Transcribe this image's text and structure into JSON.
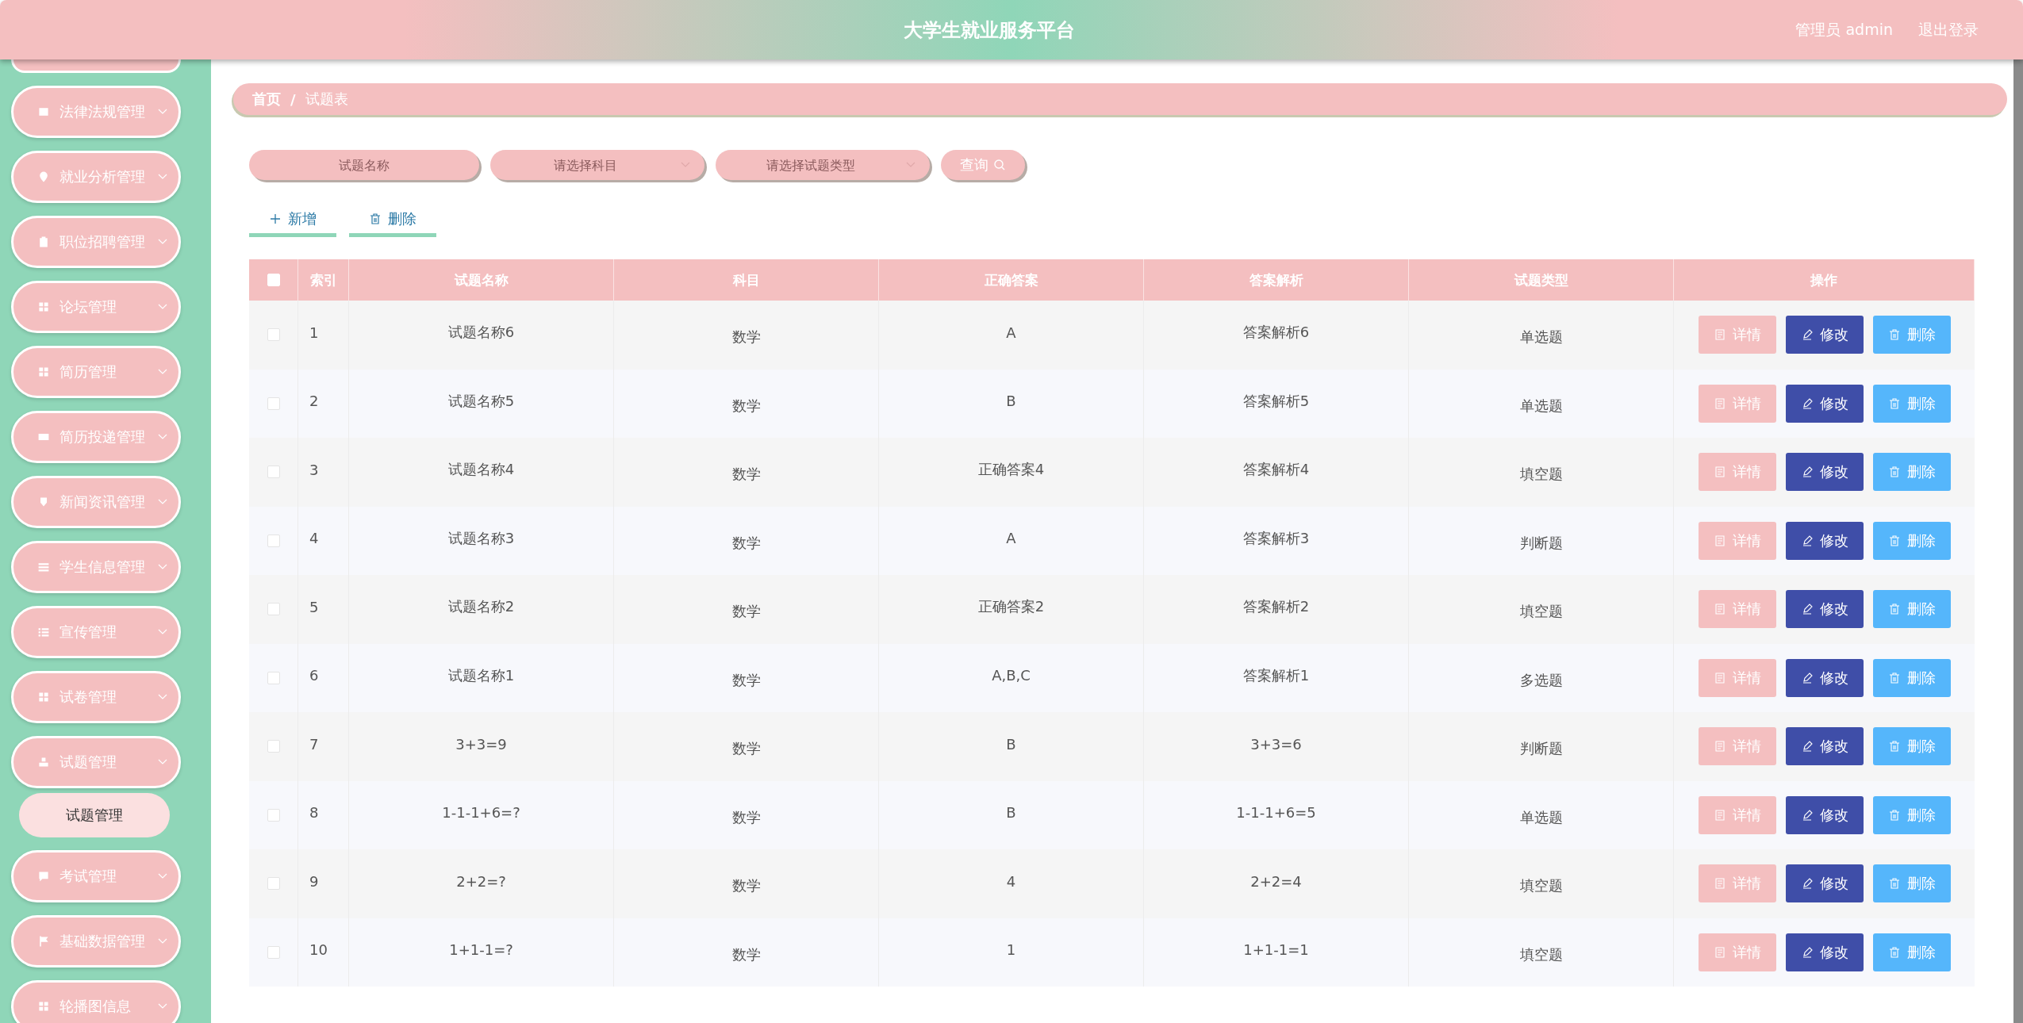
{
  "header": {
    "title": "大学生就业服务平台",
    "user": "管理员 admin",
    "logout": "退出登录"
  },
  "sidebar": {
    "items": [
      {
        "label": "法律法规管理"
      },
      {
        "label": "就业分析管理"
      },
      {
        "label": "职位招聘管理"
      },
      {
        "label": "论坛管理"
      },
      {
        "label": "简历管理"
      },
      {
        "label": "简历投递管理"
      },
      {
        "label": "新闻资讯管理"
      },
      {
        "label": "学生信息管理"
      },
      {
        "label": "宣传管理"
      },
      {
        "label": "试卷管理"
      },
      {
        "label": "试题管理",
        "children": [
          {
            "label": "试题管理"
          }
        ]
      },
      {
        "label": "考试管理"
      },
      {
        "label": "基础数据管理"
      },
      {
        "label": "轮播图信息"
      }
    ]
  },
  "breadcrumb": {
    "items": [
      "首页",
      "试题表"
    ],
    "separator": "/"
  },
  "search": {
    "fields": [
      {
        "kind": "input",
        "placeholder": "试题名称"
      },
      {
        "kind": "select",
        "placeholder": "请选择科目"
      },
      {
        "kind": "select",
        "placeholder": "请选择试题类型"
      }
    ],
    "button": "查询"
  },
  "toolbar": [
    {
      "kind": "add",
      "label": "新增"
    },
    {
      "kind": "delete",
      "label": "删除"
    }
  ],
  "table": {
    "select_all": {
      "checked": false
    },
    "columns": [
      "索引",
      "试题名称",
      "科目",
      "正确答案",
      "答案解析",
      "试题类型",
      "操作"
    ],
    "rows": [
      {
        "checked": false,
        "cells": [
          "1",
          "试题名称6",
          "数学",
          "A",
          "答案解析6",
          "单选题"
        ],
        "actions": [
          {
            "kind": "detail",
            "label": "详情"
          },
          {
            "kind": "edit",
            "label": "修改"
          },
          {
            "kind": "delete",
            "label": "删除"
          }
        ]
      },
      {
        "checked": false,
        "cells": [
          "2",
          "试题名称5",
          "数学",
          "B",
          "答案解析5",
          "单选题"
        ],
        "actions": [
          {
            "kind": "detail",
            "label": "详情"
          },
          {
            "kind": "edit",
            "label": "修改"
          },
          {
            "kind": "delete",
            "label": "删除"
          }
        ]
      },
      {
        "checked": false,
        "cells": [
          "3",
          "试题名称4",
          "数学",
          "正确答案4",
          "答案解析4",
          "填空题"
        ],
        "actions": [
          {
            "kind": "detail",
            "label": "详情"
          },
          {
            "kind": "edit",
            "label": "修改"
          },
          {
            "kind": "delete",
            "label": "删除"
          }
        ]
      },
      {
        "checked": false,
        "cells": [
          "4",
          "试题名称3",
          "数学",
          "A",
          "答案解析3",
          "判断题"
        ],
        "actions": [
          {
            "kind": "detail",
            "label": "详情"
          },
          {
            "kind": "edit",
            "label": "修改"
          },
          {
            "kind": "delete",
            "label": "删除"
          }
        ]
      },
      {
        "checked": false,
        "cells": [
          "5",
          "试题名称2",
          "数学",
          "正确答案2",
          "答案解析2",
          "填空题"
        ],
        "actions": [
          {
            "kind": "detail",
            "label": "详情"
          },
          {
            "kind": "edit",
            "label": "修改"
          },
          {
            "kind": "delete",
            "label": "删除"
          }
        ]
      },
      {
        "checked": false,
        "cells": [
          "6",
          "试题名称1",
          "数学",
          "A,B,C",
          "答案解析1",
          "多选题"
        ],
        "actions": [
          {
            "kind": "detail",
            "label": "详情"
          },
          {
            "kind": "edit",
            "label": "修改"
          },
          {
            "kind": "delete",
            "label": "删除"
          }
        ]
      },
      {
        "checked": false,
        "cells": [
          "7",
          "3+3=9",
          "数学",
          "B",
          "3+3=6",
          "判断题"
        ],
        "actions": [
          {
            "kind": "detail",
            "label": "详情"
          },
          {
            "kind": "edit",
            "label": "修改"
          },
          {
            "kind": "delete",
            "label": "删除"
          }
        ]
      },
      {
        "checked": false,
        "cells": [
          "8",
          "1-1-1+6=?",
          "数学",
          "B",
          "1-1-1+6=5",
          "单选题"
        ],
        "actions": [
          {
            "kind": "detail",
            "label": "详情"
          },
          {
            "kind": "edit",
            "label": "修改"
          },
          {
            "kind": "delete",
            "label": "删除"
          }
        ]
      },
      {
        "checked": false,
        "cells": [
          "9",
          "2+2=?",
          "数学",
          "4",
          "2+2=4",
          "填空题"
        ],
        "actions": [
          {
            "kind": "detail",
            "label": "详情"
          },
          {
            "kind": "edit",
            "label": "修改"
          },
          {
            "kind": "delete",
            "label": "删除"
          }
        ]
      },
      {
        "checked": false,
        "cells": [
          "10",
          "1+1-1=?",
          "数学",
          "1",
          "1+1-1=1",
          "填空题"
        ],
        "actions": [
          {
            "kind": "detail",
            "label": "详情"
          },
          {
            "kind": "edit",
            "label": "修改"
          },
          {
            "kind": "delete",
            "label": "删除"
          }
        ]
      }
    ]
  }
}
